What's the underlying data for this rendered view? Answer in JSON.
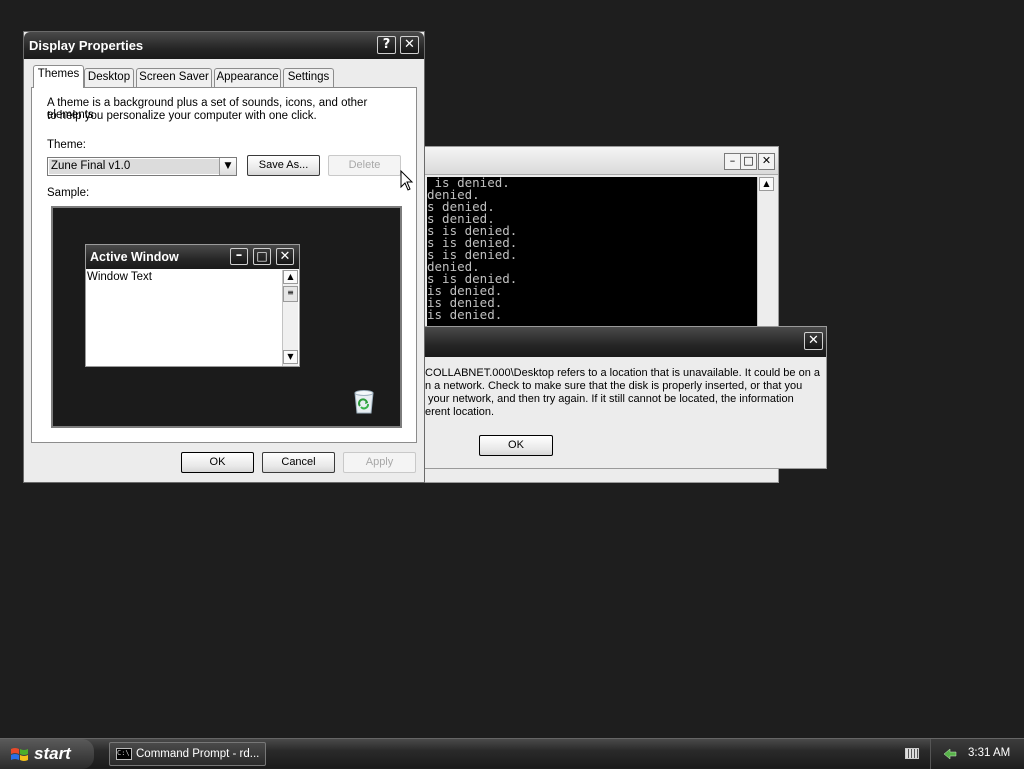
{
  "cmd_window": {
    "lines": [
      " is denied.",
      "denied.",
      "s denied.",
      "s denied.",
      "s is denied.",
      "s is denied.",
      "s is denied.",
      "denied.",
      "s is denied.",
      "is denied.",
      "is denied.",
      "is denied."
    ]
  },
  "error_dialog": {
    "lines": [
      "COLLABNET.000\\Desktop refers to a location that is unavailable. It could be on a",
      "n a network. Check to make sure that the disk is properly inserted, or that you",
      " your network, and then try again. If it still cannot be located, the information",
      "erent location."
    ],
    "ok_label": "OK"
  },
  "display_properties": {
    "title": "Display Properties",
    "tabs": [
      "Themes",
      "Desktop",
      "Screen Saver",
      "Appearance",
      "Settings"
    ],
    "description_line1": "A theme is a background plus a set of sounds, icons, and other elements",
    "description_line2": "to help you personalize your computer with one click.",
    "theme_label": "Theme:",
    "theme_value": "Zune Final v1.0",
    "save_as_label": "Save As...",
    "delete_label": "Delete",
    "sample_label": "Sample:",
    "sample": {
      "window_title": "Active Window",
      "window_text": "Window Text"
    },
    "ok_label": "OK",
    "cancel_label": "Cancel",
    "apply_label": "Apply"
  },
  "taskbar": {
    "start_label": "start",
    "task_label": "Command Prompt - rd...",
    "clock": "3:31 AM"
  }
}
